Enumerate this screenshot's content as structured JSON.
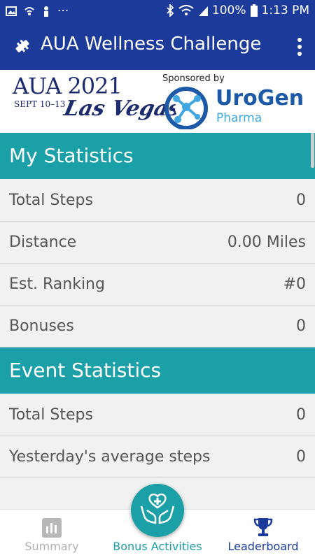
{
  "status_bar": {
    "battery": "100%",
    "time": "1:13 PM",
    "ellipsis": "···"
  },
  "app_bar": {
    "title": "AUA Wellness Challenge"
  },
  "banner": {
    "aua_logo_text": "AUA 2021",
    "aua_dates": "SEPT 10–13",
    "aua_city": "Las Vegas",
    "sponsored_by": "Sponsored by",
    "sponsor_name": "UroGen",
    "sponsor_sub": "Pharma"
  },
  "my_statistics": {
    "title": "My Statistics",
    "rows": [
      {
        "label": "Total Steps",
        "value": "0"
      },
      {
        "label": "Distance",
        "value": "0.00 Miles"
      },
      {
        "label": "Est. Ranking",
        "value": "#0"
      },
      {
        "label": "Bonuses",
        "value": "0"
      }
    ]
  },
  "event_statistics": {
    "title": "Event Statistics",
    "rows": [
      {
        "label": "Total Steps",
        "value": "0"
      },
      {
        "label": "Yesterday's average steps",
        "value": "0"
      }
    ]
  },
  "tabs": [
    {
      "label": "Summary",
      "icon": "bar-chart-icon",
      "color": "#b0b0b0"
    },
    {
      "label": "Bonus Activities",
      "icon": "hands-heart-icon",
      "color": "#1aa0a6"
    },
    {
      "label": "Leaderboard",
      "icon": "trophy-icon",
      "color": "#1c3a9a"
    }
  ],
  "colors": {
    "primary": "#1c3a9a",
    "accent": "#1aa0a6"
  }
}
